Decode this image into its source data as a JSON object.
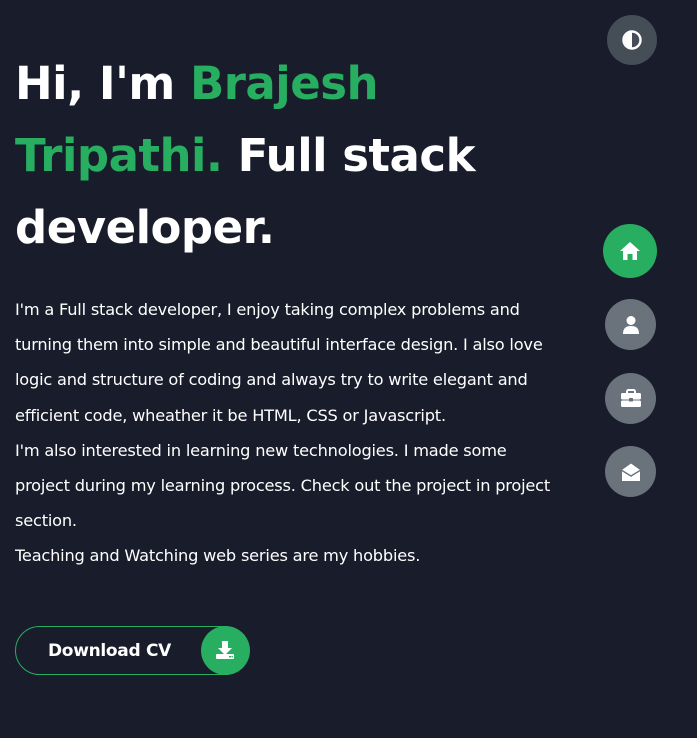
{
  "headline": {
    "part1": "Hi, I'm ",
    "name": "Brajesh Tripathi.",
    "part2": " Full stack developer."
  },
  "about": {
    "paragraphs": [
      "I'm a Full stack developer, I enjoy taking complex problems and turning them into simple and beautiful interface design. I also love logic and structure of coding and always try to write elegant and efficient code, wheather it be HTML, CSS or Javascript.",
      "I'm also interested in learning new technologies. I made some project during my learning process. Check out the project in project section.",
      "Teaching and Watching web series are my hobbies."
    ]
  },
  "download_button": {
    "label": "Download CV",
    "icon": "download-icon"
  },
  "theme_toggle": {
    "icon": "contrast-icon"
  },
  "nav": {
    "items": [
      {
        "icon": "home-icon",
        "active": true
      },
      {
        "icon": "user-icon",
        "active": false
      },
      {
        "icon": "briefcase-icon",
        "active": false
      },
      {
        "icon": "envelope-open-icon",
        "active": false
      }
    ]
  },
  "colors": {
    "background": "#191d2b",
    "accent": "#27ae60",
    "nav_inactive": "#6a737b",
    "theme_toggle_bg": "#454e56",
    "text": "#ffffff"
  }
}
